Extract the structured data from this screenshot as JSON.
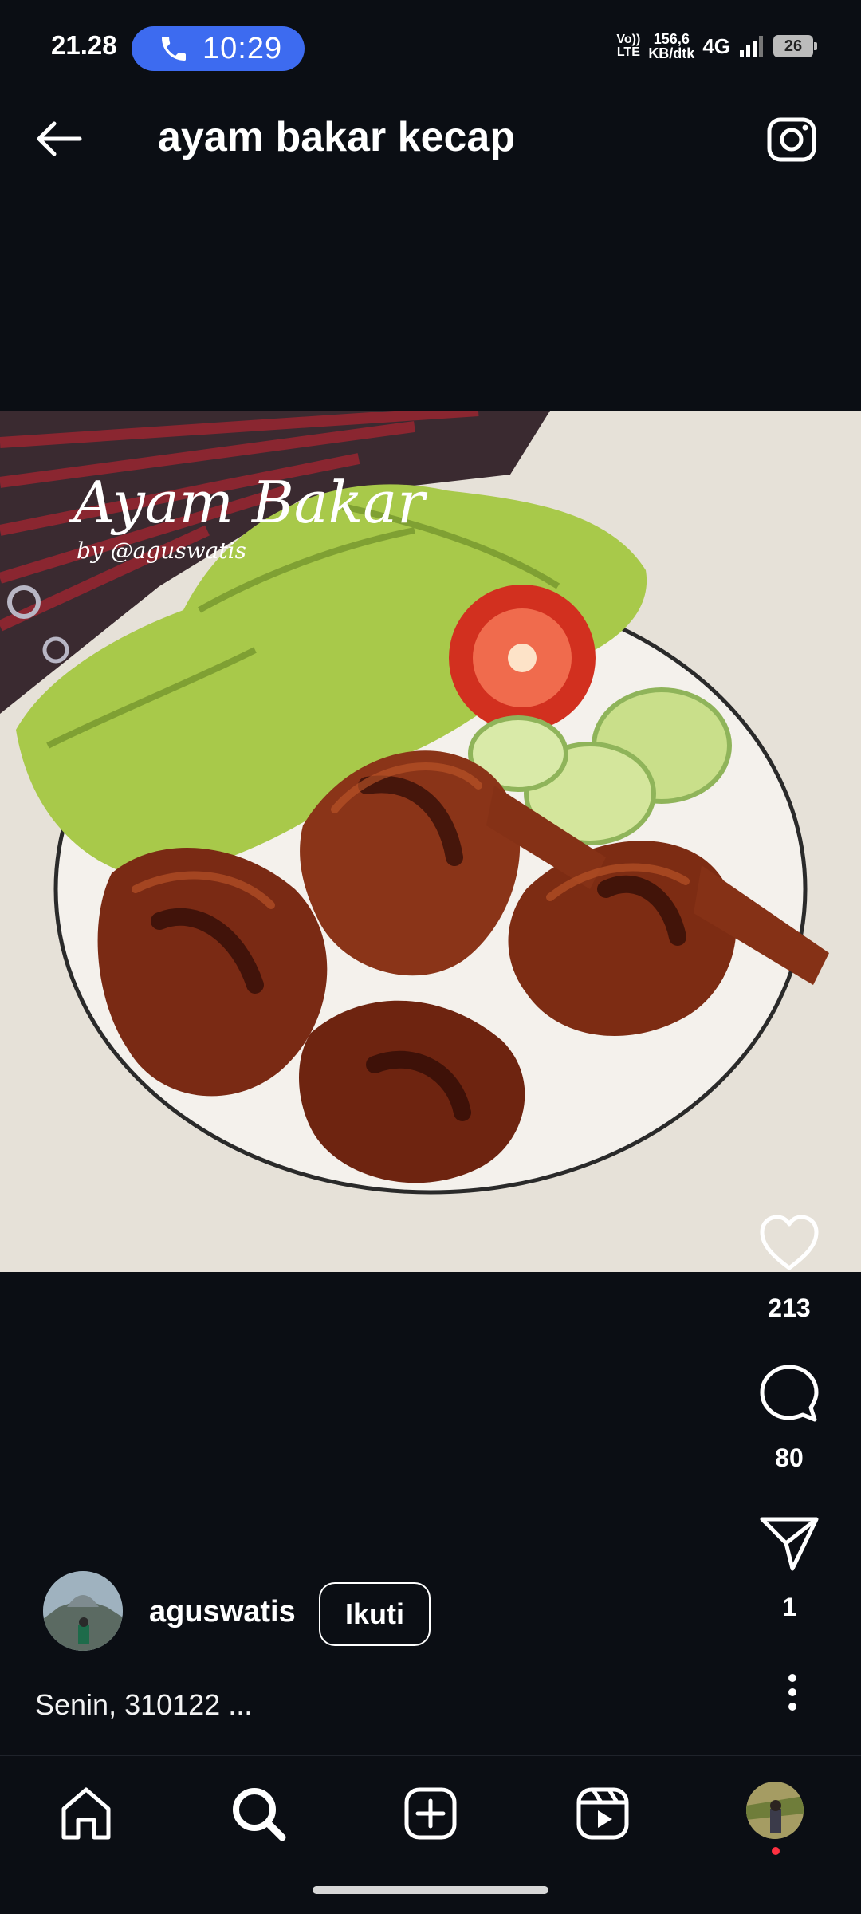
{
  "status_bar": {
    "clock": "21.28",
    "call_time": "10:29",
    "volte_top": "Vo))",
    "volte_bottom": "LTE",
    "speed_value": "156,6",
    "speed_unit": "KB/dtk",
    "network": "4G",
    "battery": "26"
  },
  "header": {
    "title": "ayam bakar kecap"
  },
  "post": {
    "image_overlay_title": "Ayam Bakar",
    "image_overlay_credit": "by @aguswatis",
    "likes": "213",
    "comments": "80",
    "shares": "1",
    "author": "aguswatis",
    "follow_label": "Ikuti",
    "caption": "Senin, 310122 ..."
  },
  "bottom_nav": {
    "items": [
      "home-icon",
      "search-icon",
      "create-icon",
      "reels-icon",
      "profile-avatar"
    ]
  },
  "colors": {
    "background": "#0b0e14",
    "call_pill": "#3d6bf0",
    "notification_dot": "#ff3040"
  }
}
